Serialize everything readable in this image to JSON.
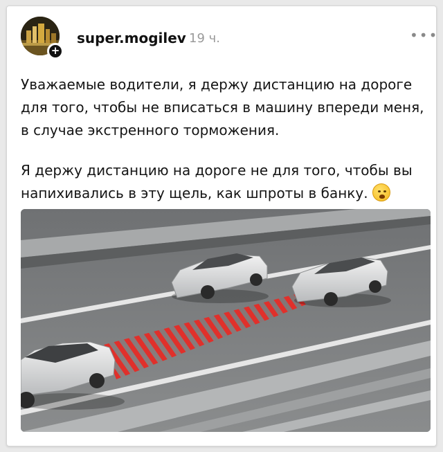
{
  "post": {
    "username": "super.mogilev",
    "time": "19 ч.",
    "more_label": "•••",
    "follow_label": "+",
    "paragraphs": [
      "Уважаемые водители, я держу дистанцию на дороге для того, чтобы не вписаться в машину впереди меня, в случае экстренного торможения.",
      "Я держу дистанцию на дороге не для того, чтобы вы напихивались в эту щель, как шпроты в банку."
    ],
    "emoji_icon": "crying-sweat-face-icon"
  },
  "photo": {
    "subject": "three-silver-cars-on-highway-with-red-hatched-gap",
    "colors": {
      "road": "#7d7f80",
      "hatch": "#e0302b",
      "car": "#d9dadb"
    }
  }
}
